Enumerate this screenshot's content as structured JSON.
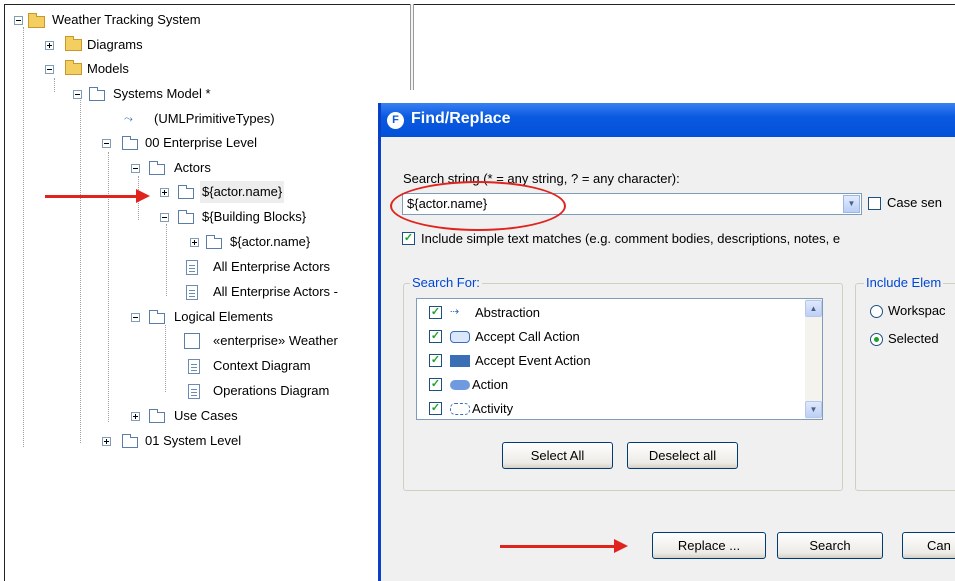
{
  "tree": {
    "root": "Weather Tracking System",
    "diagrams": "Diagrams",
    "models": "Models",
    "systems_model": "Systems Model *",
    "uml_types": "(UMLPrimitiveTypes)",
    "enterprise_level": "00 Enterprise Level",
    "actors": "Actors",
    "actor_name_1": "${actor.name}",
    "building_blocks": "${Building Blocks}",
    "actor_name_2": "${actor.name}",
    "all_actors": "All Enterprise Actors",
    "all_actors_2": "All Enterprise Actors -",
    "logical_elements": "Logical Elements",
    "enterprise_weather": "«enterprise» Weather",
    "context_diagram": "Context Diagram",
    "operations_diagram": "Operations Diagram",
    "use_cases": "Use Cases",
    "system_level": "01 System Level"
  },
  "dialog": {
    "title": "Find/Replace",
    "search_label": "Search string (* = any string, ? = any character):",
    "search_value": "${actor.name}",
    "case_sensitive": "Case sen",
    "include_simple": "Include simple text matches (e.g. comment bodies, descriptions, notes, e",
    "search_for_title": "Search For:",
    "search_for_items": [
      "Abstraction",
      "Accept Call Action",
      "Accept Event Action",
      "Action",
      "Activity"
    ],
    "include_elements_title": "Include Elem",
    "workspace_option": "Workspac",
    "selected_option": "Selected",
    "select_all": "Select All",
    "deselect_all": "Deselect all",
    "replace_button": "Replace ...",
    "search_button": "Search",
    "cancel_button": "Can"
  },
  "colors": {
    "annotation_red": "#e0231c",
    "titlebar_blue": "#0a5ae0",
    "group_title_blue": "#0046d5"
  }
}
